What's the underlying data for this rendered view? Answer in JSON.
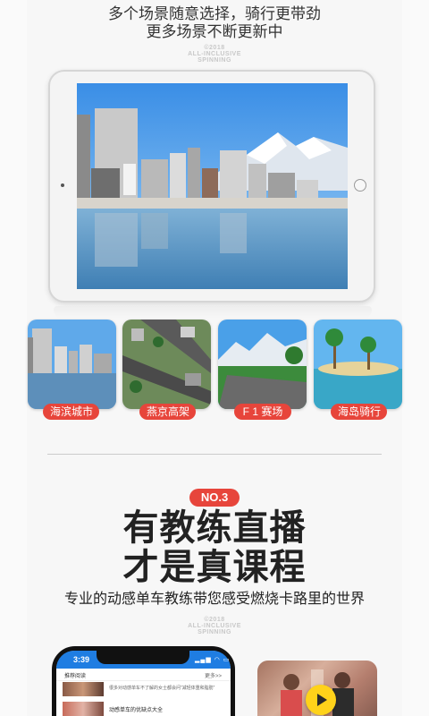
{
  "header": {
    "line1": "多个场景随意选择，骑行更带劲",
    "line2": "更多场景不断更新中",
    "watermark_year": "©2018",
    "watermark_line1": "ALL-INCLUSIVE",
    "watermark_line2": "SPINNING"
  },
  "scenes": [
    {
      "label": "海滨城市"
    },
    {
      "label": "燕京高架"
    },
    {
      "label": "F 1 赛场"
    },
    {
      "label": "海岛骑行"
    }
  ],
  "section3": {
    "badge": "NO.3",
    "title_line1": "有教练直播",
    "title_line2": "才是真课程",
    "subtitle": "专业的动感单车教练带您感受燃烧卡路里的世界",
    "watermark_year": "©2018",
    "watermark_line1": "ALL-INCLUSIVE",
    "watermark_line2": "SPINNING"
  },
  "phone": {
    "time": "3:39",
    "status_icons": "▂▄▆ ◠ ▭",
    "section_title": "推荐阅读",
    "more": "更多>>",
    "news1": "很多对动感单车不了解的女士都会问“减轻体重和脂肪”",
    "news2": "动感单车的优缺点大全"
  },
  "colors": {
    "accent": "#e7453b",
    "phone_blue": "#1f7de2",
    "play_yellow": "#ffd21a"
  }
}
